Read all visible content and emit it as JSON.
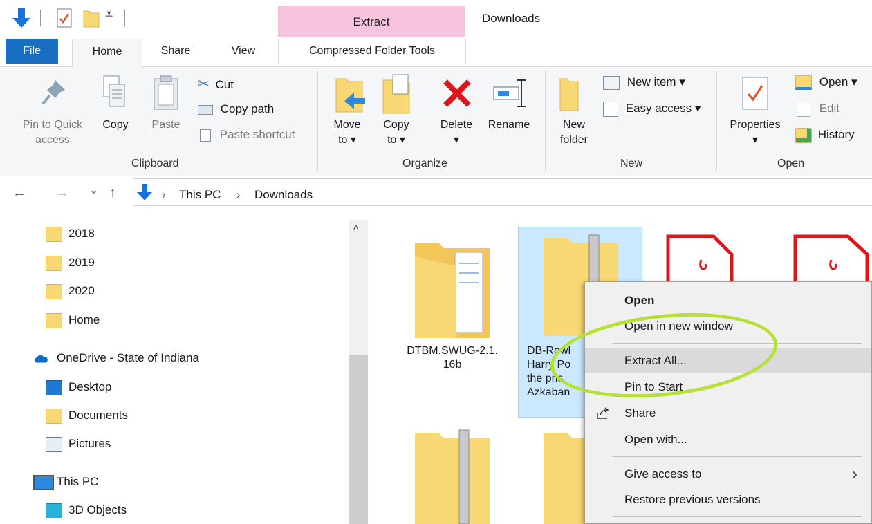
{
  "title_bar": {
    "contextual_tab": "Extract",
    "window_title": "Downloads"
  },
  "tabs": {
    "file": "File",
    "home": "Home",
    "share": "Share",
    "view": "View",
    "compressed": "Compressed Folder Tools"
  },
  "ribbon": {
    "clipboard": {
      "pin_line1": "Pin to Quick",
      "pin_line2": "access",
      "copy": "Copy",
      "paste": "Paste",
      "cut": "Cut",
      "copy_path": "Copy path",
      "paste_shortcut": "Paste shortcut",
      "group": "Clipboard"
    },
    "organize": {
      "move_line1": "Move",
      "move_line2": "to ▾",
      "copy_line1": "Copy",
      "copy_line2": "to ▾",
      "delete": "Delete",
      "delete_arrow": "▾",
      "rename": "Rename",
      "group": "Organize"
    },
    "new": {
      "new_folder_line1": "New",
      "new_folder_line2": "folder",
      "new_item": "New item ▾",
      "easy_access": "Easy access ▾",
      "group": "New"
    },
    "open": {
      "properties": "Properties",
      "properties_arrow": "▾",
      "open": "Open ▾",
      "edit": "Edit",
      "history": "History",
      "group": "Open"
    }
  },
  "address": {
    "back": "←",
    "forward": "→",
    "recent": "⌄",
    "up": "↑",
    "sep1": "›",
    "crumb1": "This PC",
    "sep2": "›",
    "crumb2": "Downloads"
  },
  "tree": [
    {
      "label": "2018",
      "icon": "folder-icon"
    },
    {
      "label": "2019",
      "icon": "folder-icon"
    },
    {
      "label": "2020",
      "icon": "folder-icon"
    },
    {
      "label": "Home",
      "icon": "folder-icon"
    },
    {
      "label": "OneDrive - State of Indiana",
      "icon": "onedrive-icon"
    },
    {
      "label": "Desktop",
      "icon": "desktop-icon"
    },
    {
      "label": "Documents",
      "icon": "folder-icon"
    },
    {
      "label": "Pictures",
      "icon": "pictures-icon"
    },
    {
      "label": "This PC",
      "icon": "computer-icon"
    },
    {
      "label": "3D Objects",
      "icon": "3d-objects-icon"
    }
  ],
  "files": {
    "f1_line1": "DTBM.SWUG-2.1.",
    "f1_line2": "16b",
    "f2_line1": "DB-Rowl",
    "f2_line2": "Harry Po",
    "f2_line3": "the pris",
    "f2_line4": "Azkaban"
  },
  "context_menu": {
    "open": "Open",
    "open_new_window": "Open in new window",
    "extract_all": "Extract All...",
    "pin_to_start": "Pin to Start",
    "share": "Share",
    "open_with": "Open with...",
    "give_access": "Give access to",
    "give_access_arrow": "›",
    "restore": "Restore previous versions"
  },
  "colors": {
    "file_tab": "#1a6fc2",
    "extract_tab": "#f8c3df",
    "selection": "#cce8ff",
    "highlight_ring": "#b5e134",
    "folder": "#f8d775"
  }
}
